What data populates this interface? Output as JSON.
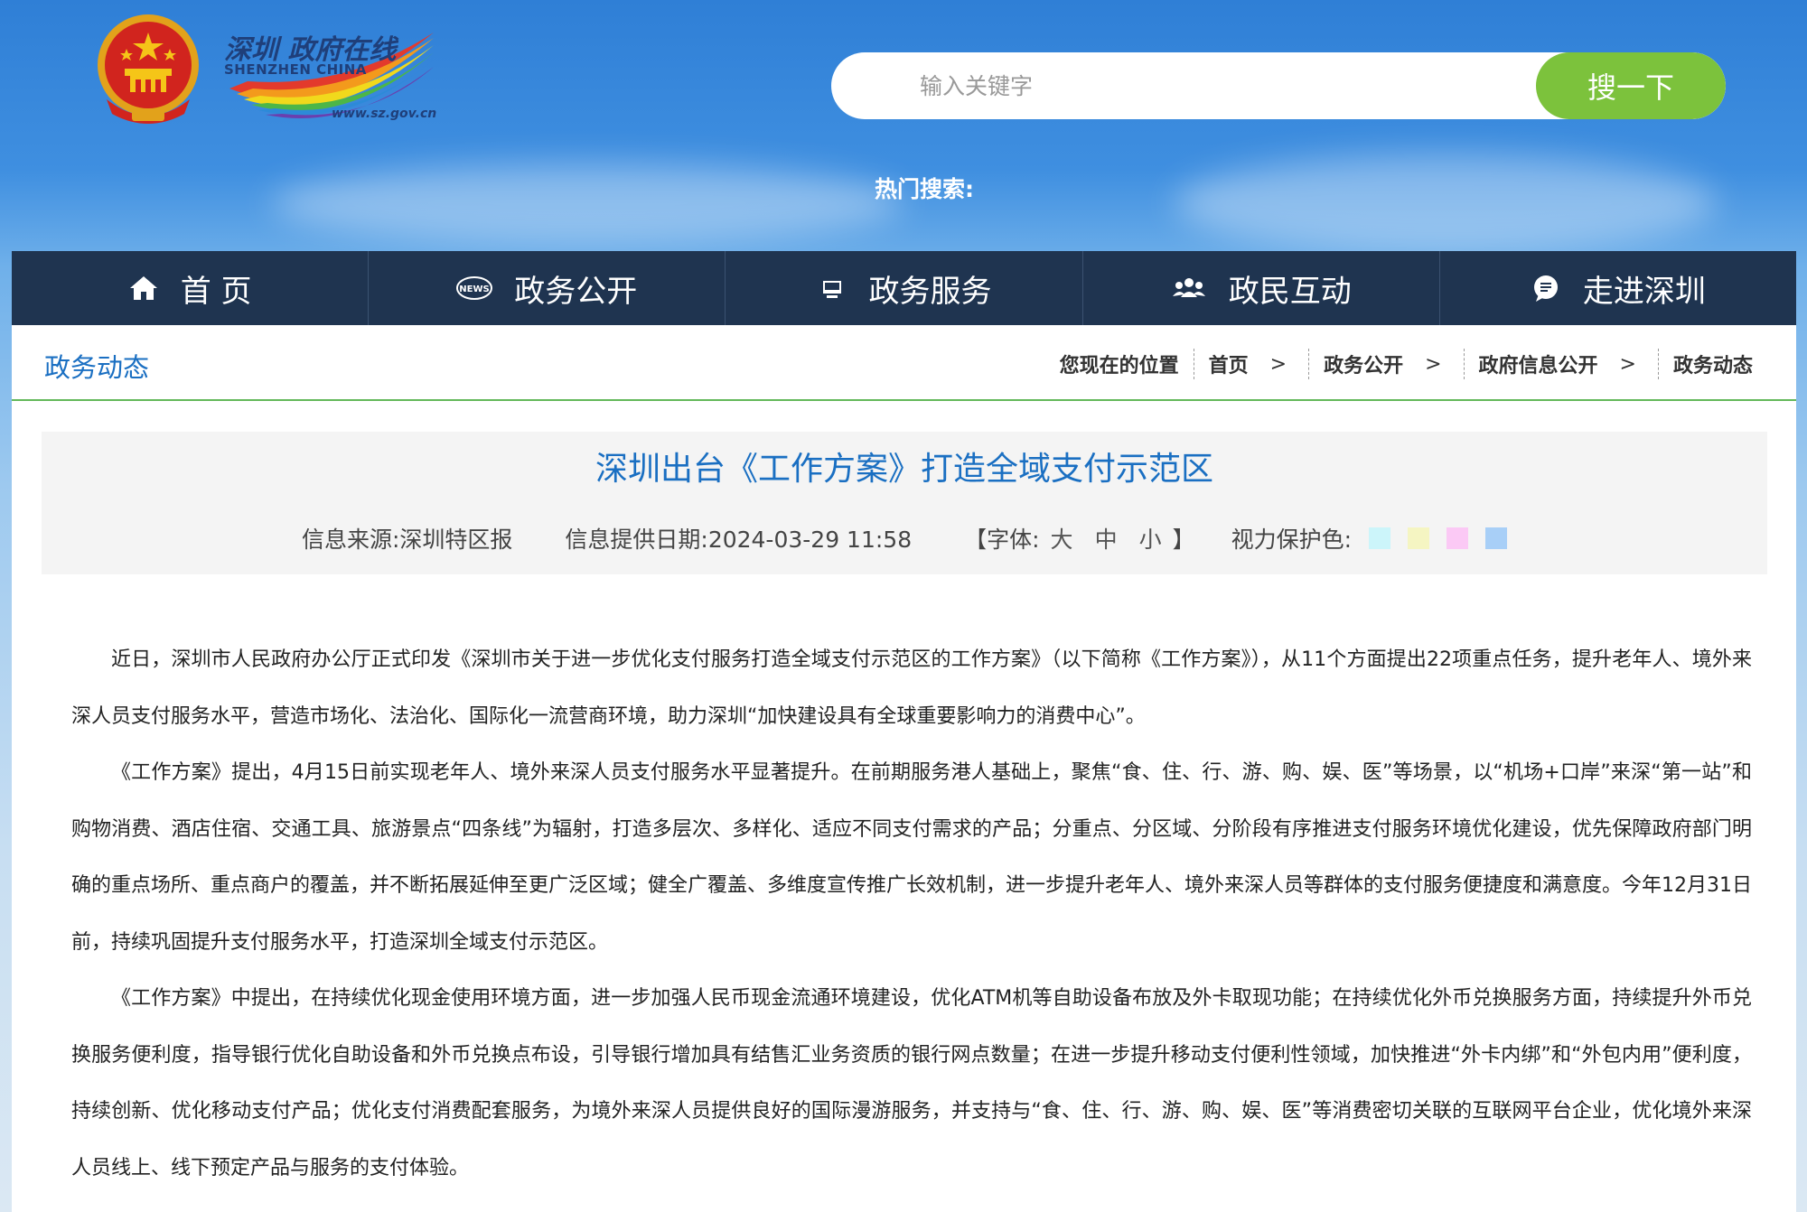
{
  "header": {
    "logo_cn": "深圳 政府在线",
    "logo_en": "SHENZHEN CHINA",
    "logo_url": "www.sz.gov.cn",
    "search_placeholder": "输入关键字",
    "search_button": "搜一下",
    "hot_search_label": "热门搜索:"
  },
  "nav": {
    "items": [
      {
        "label": "首 页",
        "icon": "home-icon"
      },
      {
        "label": "政务公开",
        "icon": "news-icon"
      },
      {
        "label": "政务服务",
        "icon": "monitor-icon"
      },
      {
        "label": "政民互动",
        "icon": "people-icon"
      },
      {
        "label": "走进深圳",
        "icon": "chat-icon"
      }
    ]
  },
  "section_title": "政务动态",
  "breadcrumb": {
    "prefix": "您现在的位置",
    "items": [
      "首页",
      "政务公开",
      "政府信息公开",
      "政务动态"
    ],
    "separator": ">"
  },
  "article": {
    "title": "深圳出台《工作方案》打造全域支付示范区",
    "source_label": "信息来源:深圳特区报",
    "date_label": "信息提供日期:2024-03-29 11:58",
    "font_size_label": "【字体:",
    "font_sizes": [
      "大",
      "中",
      "小"
    ],
    "font_size_close": "】",
    "eye_care_label": "视力保护色:",
    "eye_care_colors": [
      "#ccf5fa",
      "#f5f5c2",
      "#fbc9f5",
      "#a8cff7"
    ],
    "paragraphs": [
      "近日，深圳市人民政府办公厅正式印发《深圳市关于进一步优化支付服务打造全域支付示范区的工作方案》（以下简称《工作方案》），从11个方面提出22项重点任务，提升老年人、境外来深人员支付服务水平，营造市场化、法治化、国际化一流营商环境，助力深圳“加快建设具有全球重要影响力的消费中心”。",
      "《工作方案》提出，4月15日前实现老年人、境外来深人员支付服务水平显著提升。在前期服务港人基础上，聚焦“食、住、行、游、购、娱、医”等场景，以“机场+口岸”来深“第一站”和购物消费、酒店住宿、交通工具、旅游景点“四条线”为辐射，打造多层次、多样化、适应不同支付需求的产品；分重点、分区域、分阶段有序推进支付服务环境优化建设，优先保障政府部门明确的重点场所、重点商户的覆盖，并不断拓展延伸至更广泛区域；健全广覆盖、多维度宣传推广长效机制，进一步提升老年人、境外来深人员等群体的支付服务便捷度和满意度。今年12月31日前，持续巩固提升支付服务水平，打造深圳全域支付示范区。",
      "《工作方案》中提出，在持续优化现金使用环境方面，进一步加强人民币现金流通环境建设，优化ATM机等自助设备布放及外卡取现功能；在持续优化外币兑换服务方面，持续提升外币兑换服务便利度，指导银行优化自助设备和外币兑换点布设，引导银行增加具有结售汇业务资质的银行网点数量；在进一步提升移动支付便利性领域，加快推进“外卡内绑”和“外包内用”便利度，持续创新、优化移动支付产品；优化支付消费配套服务，为境外来深人员提供良好的国际漫游服务，并支持与“食、住、行、游、购、娱、医”等消费密切关联的互联网平台企业，优化境外来深人员线上、线下预定产品与服务的支付体验。"
    ]
  }
}
